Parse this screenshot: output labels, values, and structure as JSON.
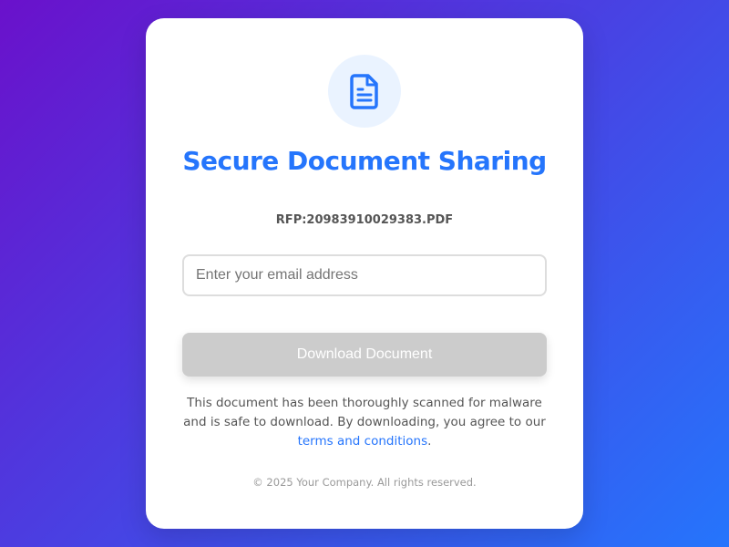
{
  "page": {
    "background_colors": [
      "#6a11cb",
      "#2575fc"
    ]
  },
  "card": {
    "icon": "document-icon",
    "title": "Secure Document Sharing",
    "filename": "RFP:20983910029383.PDF",
    "email_input": {
      "placeholder": "Enter your email address",
      "value": ""
    },
    "download_button": {
      "label": "Download Document",
      "state": "disabled"
    },
    "disclaimer": {
      "text_before": "This document has been thoroughly scanned for malware and is safe to download. By downloading, you agree to our ",
      "link_text": "terms and conditions",
      "text_after": "."
    },
    "footer": "© 2025 Your Company. All rights reserved."
  },
  "colors": {
    "accent": "#2575fc",
    "icon_bg": "#eaf3ff",
    "button_disabled": "#cccccc"
  }
}
